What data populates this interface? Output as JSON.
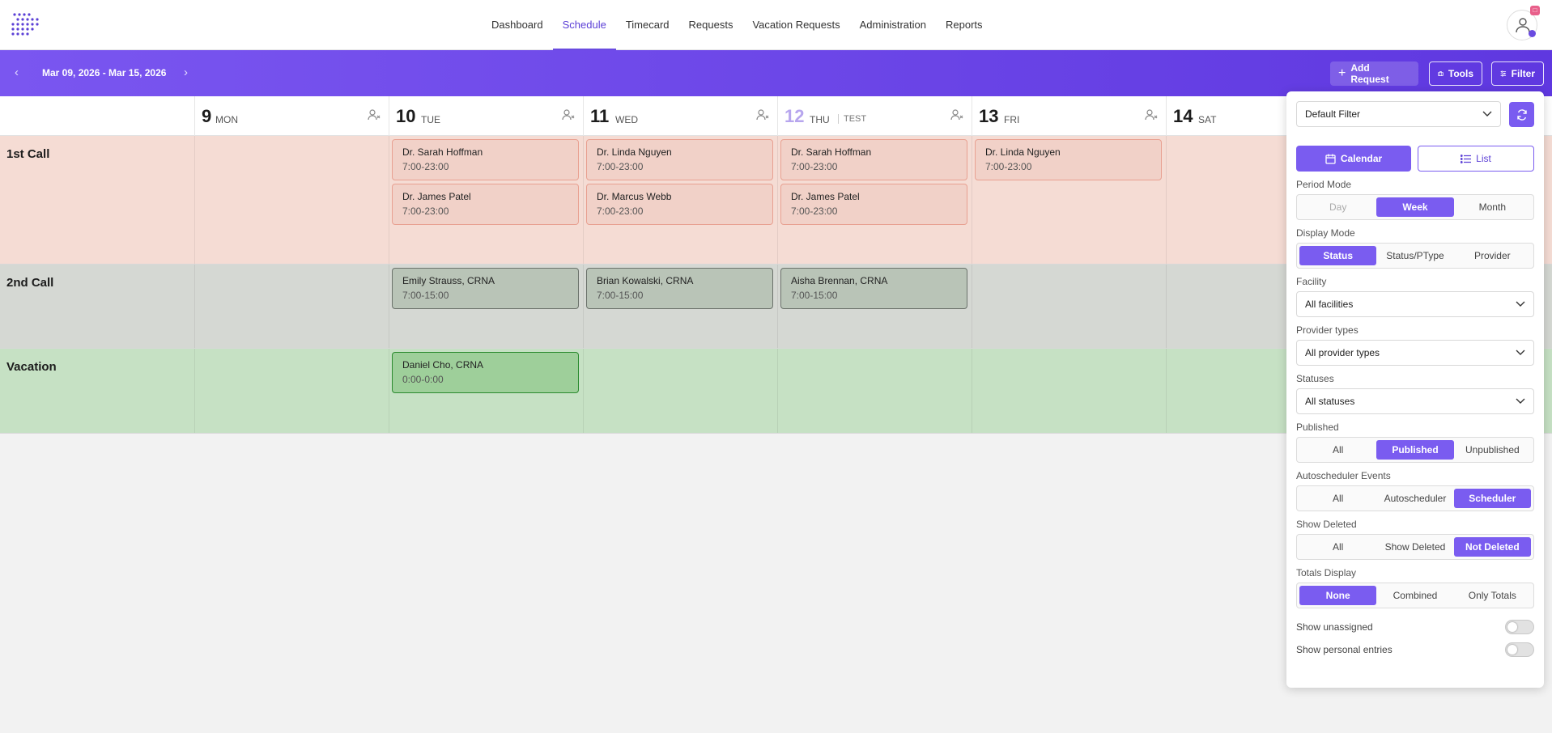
{
  "nav": {
    "links": [
      "Dashboard",
      "Schedule",
      "Timecard",
      "Requests",
      "Vacation Requests",
      "Administration",
      "Reports"
    ],
    "active_index": 1,
    "accent": "#6a4be0"
  },
  "toolbar": {
    "date_range": "Mar 09, 2026 - Mar 15, 2026",
    "add_request": "Add Request",
    "tools": "Tools",
    "filter": "Filter"
  },
  "days": [
    {
      "num": "9",
      "name": "MON",
      "extra": ""
    },
    {
      "num": "10",
      "name": "TUE",
      "extra": ""
    },
    {
      "num": "11",
      "name": "WED",
      "extra": ""
    },
    {
      "num": "12",
      "name": "THU",
      "extra": "TEST"
    },
    {
      "num": "13",
      "name": "FRI",
      "extra": ""
    },
    {
      "num": "14",
      "name": "SAT",
      "extra": ""
    }
  ],
  "rows": [
    {
      "label": "1st Call",
      "color": "#f5dcd4"
    },
    {
      "label": "2nd Call",
      "color": "#d5d8d3"
    },
    {
      "label": "Vacation",
      "color": "#c6e1c4"
    }
  ],
  "events": [
    {
      "row": 0,
      "day": 1,
      "slot": 0,
      "name": "Dr. Sarah Hoffman",
      "time": "7:00-23:00",
      "kind": "red"
    },
    {
      "row": 0,
      "day": 1,
      "slot": 1,
      "name": "Dr. James Patel",
      "time": "7:00-23:00",
      "kind": "red"
    },
    {
      "row": 0,
      "day": 2,
      "slot": 0,
      "name": "Dr. Linda Nguyen",
      "time": "7:00-23:00",
      "kind": "red"
    },
    {
      "row": 0,
      "day": 2,
      "slot": 1,
      "name": "Dr. Marcus Webb",
      "time": "7:00-23:00",
      "kind": "red"
    },
    {
      "row": 0,
      "day": 3,
      "slot": 0,
      "name": "Dr. Sarah Hoffman",
      "time": "7:00-23:00",
      "kind": "red"
    },
    {
      "row": 0,
      "day": 3,
      "slot": 1,
      "name": "Dr. James Patel",
      "time": "7:00-23:00",
      "kind": "red"
    },
    {
      "row": 0,
      "day": 4,
      "slot": 0,
      "name": "Dr. Linda Nguyen",
      "time": "7:00-23:00",
      "kind": "red"
    },
    {
      "row": 1,
      "day": 1,
      "slot": 0,
      "name": "Emily Strauss, CRNA",
      "time": "7:00-15:00",
      "kind": "gray"
    },
    {
      "row": 1,
      "day": 2,
      "slot": 0,
      "name": "Brian Kowalski, CRNA",
      "time": "7:00-15:00",
      "kind": "gray"
    },
    {
      "row": 1,
      "day": 3,
      "slot": 0,
      "name": "Aisha Brennan, CRNA",
      "time": "7:00-15:00",
      "kind": "gray"
    },
    {
      "row": 2,
      "day": 1,
      "slot": 0,
      "name": "Daniel Cho, CRNA",
      "time": "0:00-0:00",
      "kind": "green"
    }
  ],
  "filter": {
    "preset": "Default Filter",
    "calendar_label": "Calendar",
    "list_label": "List",
    "period_mode": {
      "label": "Period Mode",
      "options": [
        "Day",
        "Week",
        "Month"
      ],
      "active": 1
    },
    "display_mode": {
      "label": "Display Mode",
      "options": [
        "Status",
        "Status/PType",
        "Provider"
      ],
      "active": 0
    },
    "facility": {
      "label": "Facility",
      "value": "All facilities"
    },
    "provider_types": {
      "label": "Provider types",
      "value": "All provider types"
    },
    "statuses": {
      "label": "Statuses",
      "value": "All statuses"
    },
    "published": {
      "label": "Published",
      "options": [
        "All",
        "Published",
        "Unpublished"
      ],
      "active": 1
    },
    "autoscheduler": {
      "label": "Autoscheduler Events",
      "options": [
        "All",
        "Autoscheduler",
        "Scheduler"
      ],
      "active": 2
    },
    "show_deleted": {
      "label": "Show Deleted",
      "options": [
        "All",
        "Show Deleted",
        "Not Deleted"
      ],
      "active": 2
    },
    "totals_display": {
      "label": "Totals Display",
      "options": [
        "None",
        "Combined",
        "Only Totals"
      ],
      "active": 0
    },
    "show_unassigned": "Show unassigned",
    "show_personal": "Show personal entries"
  }
}
